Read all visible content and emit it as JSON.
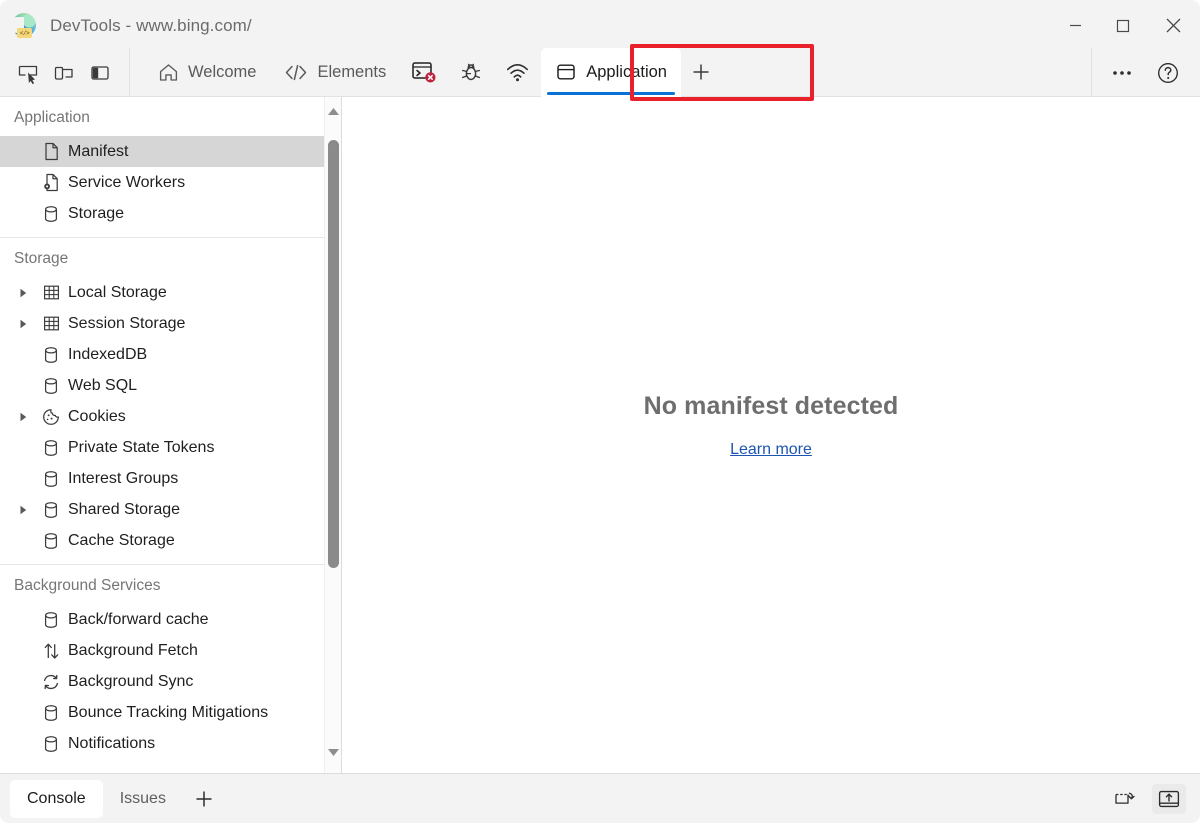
{
  "window": {
    "title": "DevTools - www.bing.com/",
    "logo_badge": "</>",
    "controls": [
      {
        "name": "minimize",
        "label": "Minimize"
      },
      {
        "name": "maximize",
        "label": "Maximize"
      },
      {
        "name": "close",
        "label": "Close"
      }
    ]
  },
  "toolbar": {
    "left_icons": [
      {
        "name": "inspect-element-icon",
        "label": "Inspect"
      },
      {
        "name": "device-emulation-icon",
        "label": "Toggle device emulation"
      },
      {
        "name": "dock-side-icon",
        "label": "Dock side"
      }
    ],
    "right_icons": [
      {
        "name": "more-options-icon",
        "label": "Customize and control DevTools"
      },
      {
        "name": "help-icon",
        "label": "Help"
      }
    ]
  },
  "tabs": [
    {
      "label": "Welcome",
      "icon": "home-icon",
      "active": false,
      "icon_only": false
    },
    {
      "label": "Elements",
      "icon": "code-icon",
      "active": false,
      "icon_only": false
    },
    {
      "label": "",
      "icon": "console-error-icon",
      "active": false,
      "icon_only": true
    },
    {
      "label": "",
      "icon": "bug-icon",
      "active": false,
      "icon_only": true
    },
    {
      "label": "",
      "icon": "network-icon",
      "active": false,
      "icon_only": true
    },
    {
      "label": "Application",
      "icon": "application-icon",
      "active": true,
      "icon_only": false
    }
  ],
  "tab_add_label": "+",
  "annotation": {
    "color": "#e8212b",
    "target": "Application"
  },
  "active_tab_accent": "#0c71d7",
  "sidebar": {
    "sections": [
      {
        "title": "Application",
        "items": [
          {
            "label": "Manifest",
            "icon": "document-icon",
            "twisty": false,
            "selected": true
          },
          {
            "label": "Service Workers",
            "icon": "service-worker-icon",
            "twisty": false,
            "selected": false
          },
          {
            "label": "Storage",
            "icon": "database-icon",
            "twisty": false,
            "selected": false
          }
        ]
      },
      {
        "title": "Storage",
        "items": [
          {
            "label": "Local Storage",
            "icon": "table-icon",
            "twisty": true,
            "selected": false
          },
          {
            "label": "Session Storage",
            "icon": "table-icon",
            "twisty": true,
            "selected": false
          },
          {
            "label": "IndexedDB",
            "icon": "database-icon",
            "twisty": false,
            "selected": false
          },
          {
            "label": "Web SQL",
            "icon": "database-icon",
            "twisty": false,
            "selected": false
          },
          {
            "label": "Cookies",
            "icon": "cookie-icon",
            "twisty": true,
            "selected": false
          },
          {
            "label": "Private State Tokens",
            "icon": "database-icon",
            "twisty": false,
            "selected": false
          },
          {
            "label": "Interest Groups",
            "icon": "database-icon",
            "twisty": false,
            "selected": false
          },
          {
            "label": "Shared Storage",
            "icon": "database-icon",
            "twisty": true,
            "selected": false
          },
          {
            "label": "Cache Storage",
            "icon": "database-icon",
            "twisty": false,
            "selected": false
          }
        ]
      },
      {
        "title": "Background Services",
        "items": [
          {
            "label": "Back/forward cache",
            "icon": "database-icon",
            "twisty": false,
            "selected": false
          },
          {
            "label": "Background Fetch",
            "icon": "arrows-updown-icon",
            "twisty": false,
            "selected": false
          },
          {
            "label": "Background Sync",
            "icon": "sync-icon",
            "twisty": false,
            "selected": false
          },
          {
            "label": "Bounce Tracking Mitigations",
            "icon": "database-icon",
            "twisty": false,
            "selected": false
          },
          {
            "label": "Notifications",
            "icon": "database-icon",
            "twisty": false,
            "selected": false
          }
        ]
      }
    ],
    "scrollbar": {
      "thumb_top_pct": 6,
      "thumb_height_pct": 63
    }
  },
  "main_panel": {
    "empty_title": "No manifest detected",
    "empty_link": "Learn more",
    "link_color": "#1c54b2"
  },
  "drawer": {
    "tabs": [
      {
        "label": "Console",
        "active": true
      },
      {
        "label": "Issues",
        "active": false
      }
    ],
    "add_label": "+",
    "right_icons": [
      {
        "name": "restore-drawer-icon",
        "label": "Restore drawer"
      },
      {
        "name": "close-drawer-icon",
        "label": "Close drawer"
      }
    ]
  }
}
